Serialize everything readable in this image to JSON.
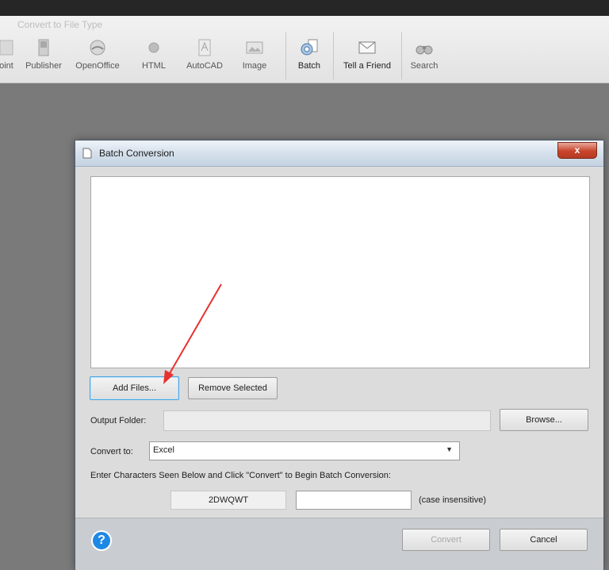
{
  "ribbon": {
    "group_label": "Convert to File Type",
    "buttons": [
      {
        "label": "oint",
        "icon": "powerpoint-icon"
      },
      {
        "label": "Publisher",
        "icon": "publisher-icon"
      },
      {
        "label": "OpenOffice",
        "icon": "openoffice-icon"
      },
      {
        "label": "HTML",
        "icon": "html-icon"
      },
      {
        "label": "AutoCAD",
        "icon": "autocad-icon"
      },
      {
        "label": "Image",
        "icon": "image-icon"
      },
      {
        "label": "Batch",
        "icon": "batch-gear-icon"
      },
      {
        "label": "Tell a Friend",
        "icon": "envelope-icon"
      },
      {
        "label": "Search",
        "icon": "binoculars-icon"
      }
    ]
  },
  "dialog": {
    "title": "Batch Conversion",
    "close_label": "x",
    "add_files_label": "Add Files...",
    "remove_selected_label": "Remove Selected",
    "output_folder_label": "Output Folder:",
    "output_folder_value": "",
    "browse_label": "Browse...",
    "convert_to_label": "Convert to:",
    "convert_to_value": "Excel",
    "instructions": "Enter Characters Seen Below and Click \"Convert\" to Begin Batch Conversion:",
    "captcha_code": "2DWQWT",
    "captcha_input": "",
    "case_note": "(case insensitive)",
    "help_label": "?",
    "convert_label": "Convert",
    "cancel_label": "Cancel"
  },
  "colors": {
    "annotation_arrow": "#e8312e",
    "help_button": "#1e88e5",
    "close_button": "#c8442b"
  }
}
